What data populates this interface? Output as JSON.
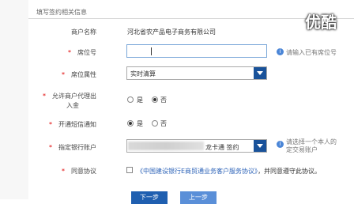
{
  "watermark": "优酷",
  "section_title": "填写签约相关信息",
  "merchant_label": "商户名称",
  "merchant_value": "河北省农产品电子商务有限公司",
  "seat_label": "席位号",
  "seat_hint": "请输入已有席位号",
  "seat_attr_label": "席位属性",
  "seat_attr_value": "实时清算",
  "allow_label_line1": "允许商户代理出",
  "allow_label_line2": "入金",
  "allow_yes": "是",
  "allow_no": "否",
  "sms_label": "开通短信通知",
  "sms_yes": "是",
  "sms_no": "否",
  "bank_label": "指定银行账户",
  "bank_suffix": "龙卡通 签约",
  "bank_hint_line1": "请选择一个本人的",
  "bank_hint_line2": "定交易账户",
  "agree_label": "同意协议",
  "agree_link": "《中国建设银行E商贸通业务客户服务协议》",
  "agree_tail": "，并同意遵守此协议。",
  "btn_next": "下一步",
  "btn_prev": "上一步",
  "required_mark": "*",
  "colors": {
    "primary": "#1f5fb0",
    "required": "#e00000"
  }
}
